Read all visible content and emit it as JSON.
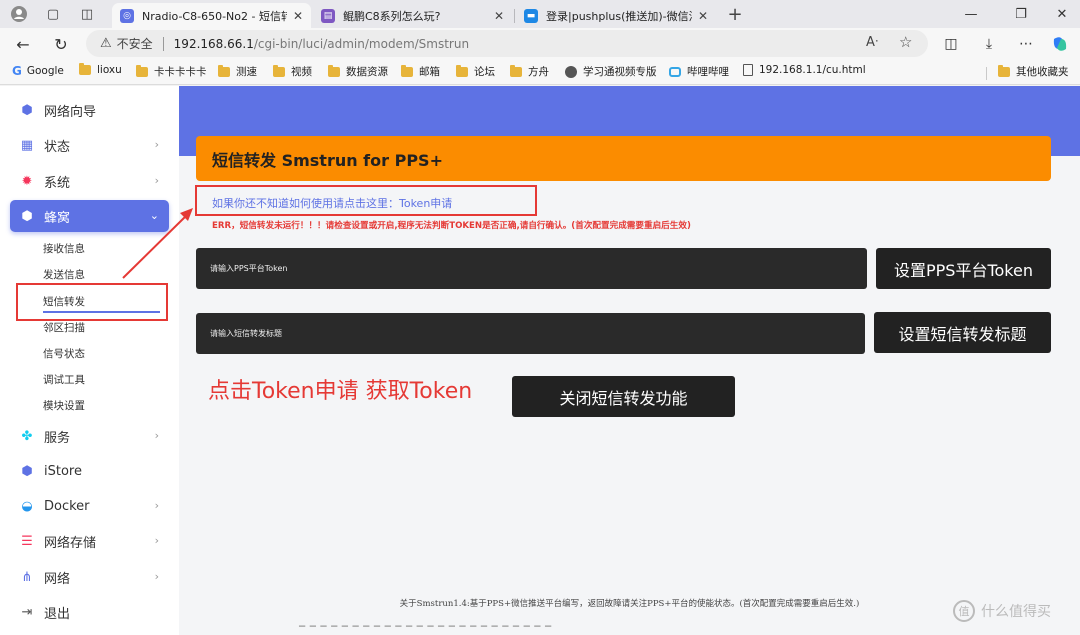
{
  "tabs": [
    {
      "label": "Nradio-C8-650-No2 - 短信转发",
      "active": true
    },
    {
      "label": "鲲鹏C8系列怎么玩?",
      "active": false
    },
    {
      "label": "登录|pushplus(推送加)-微信消息推",
      "active": false
    }
  ],
  "address": {
    "security_label": "不安全",
    "host": "192.168.66.1",
    "path": "/cgi-bin/luci/admin/modem/Smstrun"
  },
  "bookmarks": [
    "Google",
    "lioxu",
    "卡卡卡卡卡",
    "测速",
    "视频",
    "数据资源",
    "邮箱",
    "论坛",
    "方舟",
    "学习通视频专版",
    "哔哩哔哩",
    "192.168.1.1/cu.html",
    "其他收藏夹"
  ],
  "sidebar": {
    "items": [
      {
        "label": "网络向导",
        "icon": "cube-icon"
      },
      {
        "label": "状态",
        "icon": "grid-icon"
      },
      {
        "label": "系统",
        "icon": "gear-icon"
      },
      {
        "label": "蜂窝",
        "icon": "cube-icon"
      },
      {
        "label": "服务",
        "icon": "puzzle-icon"
      },
      {
        "label": "iStore",
        "icon": "cube-icon"
      },
      {
        "label": "Docker",
        "icon": "docker-icon"
      },
      {
        "label": "网络存储",
        "icon": "database-icon"
      },
      {
        "label": "网络",
        "icon": "network-icon"
      },
      {
        "label": "退出",
        "icon": "logout-icon"
      }
    ],
    "subitems": [
      "接收信息",
      "发送信息",
      "短信转发",
      "邻区扫描",
      "信号状态",
      "调试工具",
      "模块设置"
    ]
  },
  "main": {
    "title": "短信转发 Smstrun for PPS+",
    "help_link": "如果你还不知道如何使用请点击这里：Token申请",
    "error": "ERR，短信转发未运行！！！请检查设置或开启,程序无法判断TOKEN是否正确,请自行确认。(首次配置完成需要重启后生效)",
    "token_placeholder": "请输入PPS平台Token",
    "token_button": "设置PPS平台Token",
    "title_placeholder": "请输入短信转发标题",
    "title_button": "设置短信转发标题",
    "close_button": "关闭短信转发功能",
    "annotation": "点击Token申请 获取Token",
    "footer": "关于Smstrun1.4:基于PPS+微信推送平台编写，返回故障请关注PPS+平台的使能状态。(首次配置完成需要重启后生效.)",
    "watermark": "什么值得买"
  },
  "colors": {
    "accent": "#5e72e4",
    "card_header": "#fb8c00",
    "annotation_red": "#e53935",
    "dark_button": "#222222"
  }
}
